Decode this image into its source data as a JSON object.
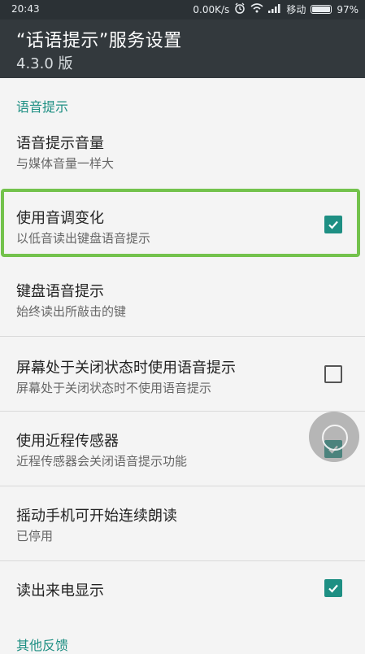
{
  "status_bar": {
    "time": "20:43",
    "net_speed": "0.00K/s",
    "carrier": "移动",
    "battery_percent": "97%",
    "battery_level": 0.97,
    "icons": [
      "alarm-icon",
      "wifi-icon",
      "signal-icon",
      "battery-icon"
    ]
  },
  "app_bar": {
    "title": "“话语提示”服务设置",
    "version": "4.3.0 版"
  },
  "sections": {
    "voice_hint_header": "语音提示",
    "other_feedback_header": "其他反馈"
  },
  "prefs": [
    {
      "label": "语音提示音量",
      "summary": "与媒体音量一样大",
      "checkbox": null
    },
    {
      "label": "使用音调变化",
      "summary": "以低音读出键盘语音提示",
      "checkbox": true
    },
    {
      "label": "键盘语音提示",
      "summary": "始终读出所敲击的键",
      "checkbox": null
    },
    {
      "label": "屏幕处于关闭状态时使用语音提示",
      "summary": "屏幕处于关闭状态时不使用语音提示",
      "checkbox": false
    },
    {
      "label": "使用近程传感器",
      "summary": "近程传感器会关闭语音提示功能",
      "checkbox": true
    },
    {
      "label": "摇动手机可开始连续朗读",
      "summary": "已停用",
      "checkbox": null
    },
    {
      "label": "读出来电显示",
      "summary": "",
      "checkbox": true
    }
  ],
  "colors": {
    "accent": "#1e8f83",
    "highlight": "#73c24c",
    "appbar": "#33393d",
    "statusbar": "#2b3135"
  }
}
